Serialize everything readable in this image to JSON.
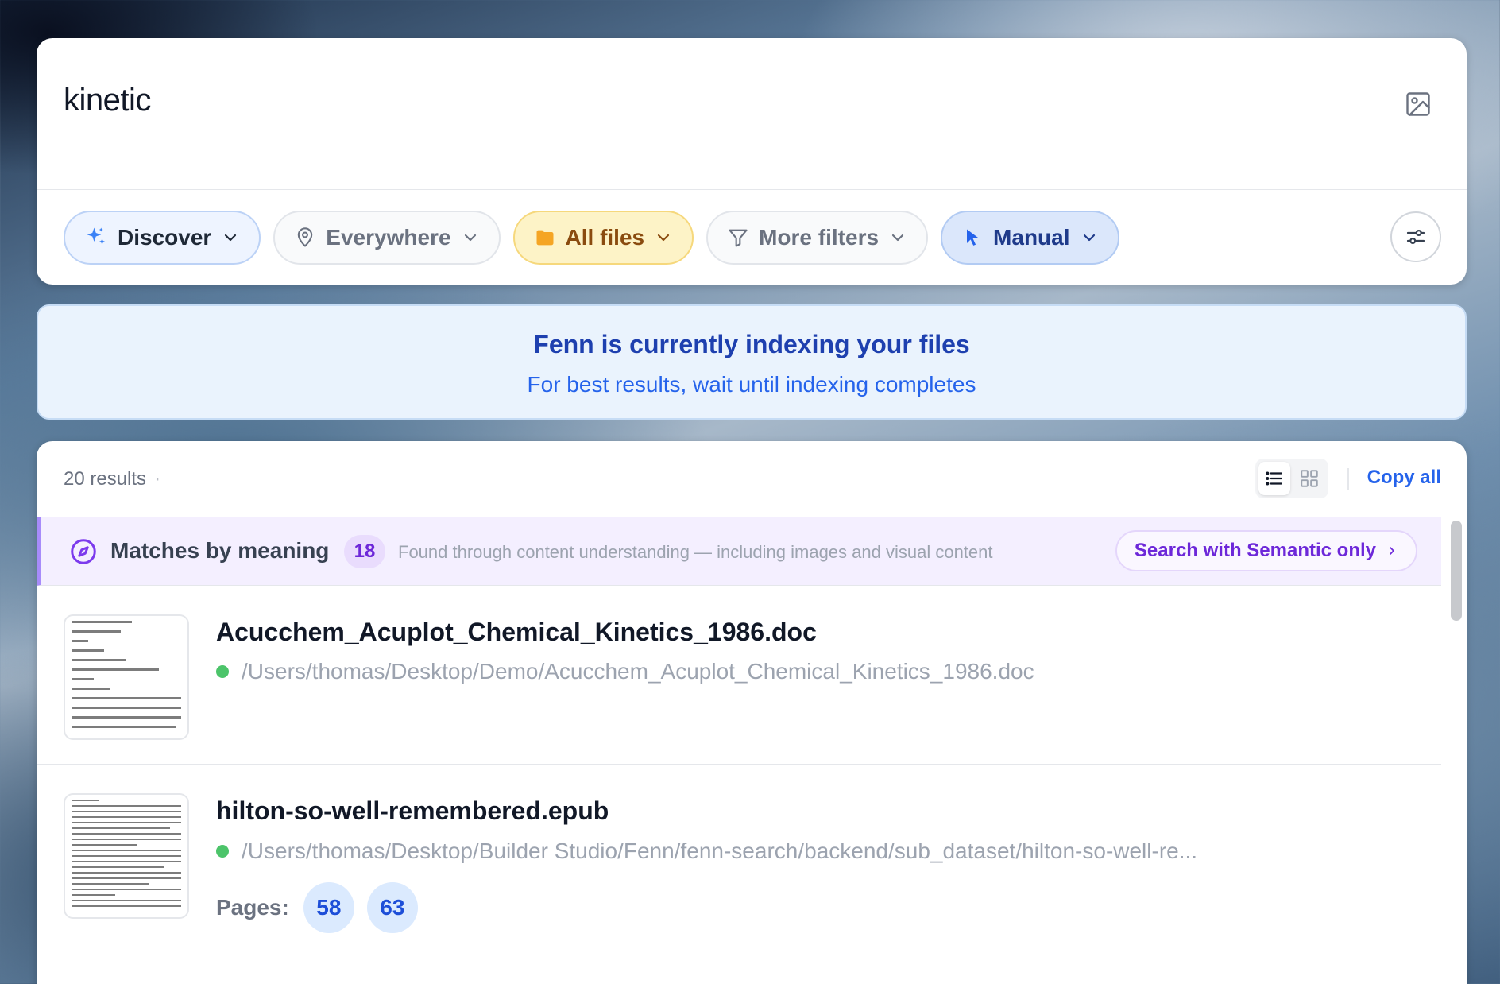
{
  "search": {
    "query": "kinetic"
  },
  "filters": {
    "discover": "Discover",
    "location": "Everywhere",
    "file_type": "All files",
    "more": "More filters",
    "mode": "Manual"
  },
  "banner": {
    "title": "Fenn is currently indexing your files",
    "subtitle": "For best results, wait until indexing completes"
  },
  "results": {
    "count_label": "20 results",
    "separator": "·",
    "copy_all": "Copy all",
    "group": {
      "title": "Matches by meaning",
      "count": "18",
      "description": "Found through content understanding — including images and visual content",
      "action": "Search with Semantic only"
    },
    "items": [
      {
        "title": "Acucchem_Acuplot_Chemical_Kinetics_1986.doc",
        "path": "/Users/thomas/Desktop/Demo/Acucchem_Acuplot_Chemical_Kinetics_1986.doc"
      },
      {
        "title": "hilton-so-well-remembered.epub",
        "path": "/Users/thomas/Desktop/Builder Studio/Fenn/fenn-search/backend/sub_dataset/hilton-so-well-re...",
        "pages_label": "Pages:",
        "pages": [
          "58",
          "63"
        ]
      }
    ]
  },
  "colors": {
    "accent_blue": "#2563eb",
    "semantic_purple": "#6d28d9",
    "status_green": "#4cc46a",
    "all_files_yellow": "#fdf3c7"
  },
  "icons": {
    "image_search": "image-icon",
    "discover": "sparkles-icon",
    "location": "map-pin-icon",
    "file_type": "folder-icon",
    "more": "filter-icon",
    "mode": "cursor-icon",
    "settings": "sliders-icon",
    "list_view": "list-icon",
    "grid_view": "grid-icon",
    "meaning": "compass-icon"
  }
}
